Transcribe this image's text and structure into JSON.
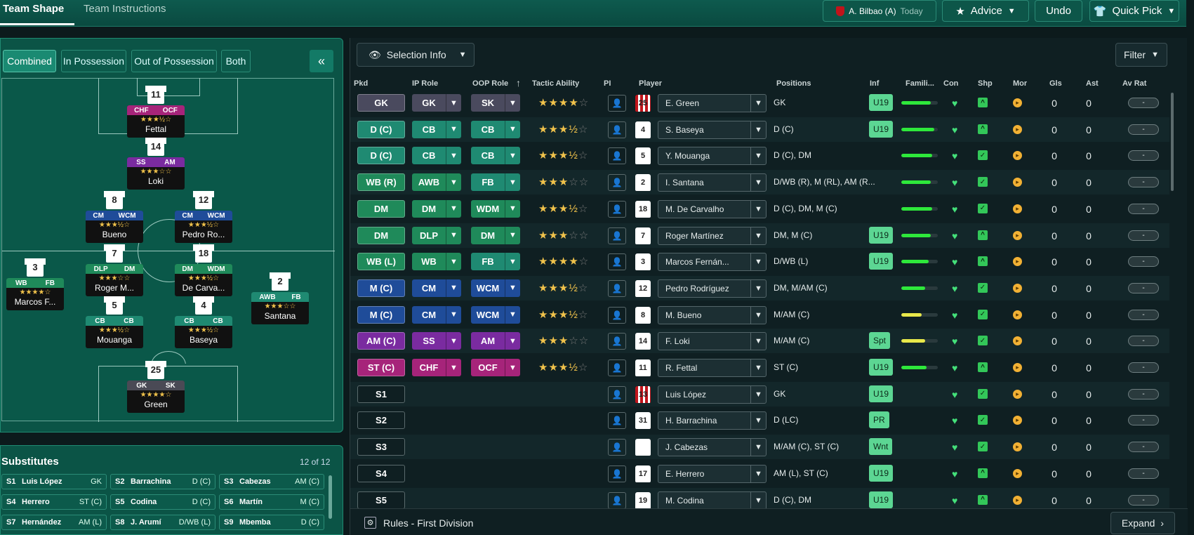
{
  "tabs": {
    "team_shape": "Team Shape",
    "team_instructions": "Team Instructions"
  },
  "topbar": {
    "match": "A. Bilbao (A)",
    "when": "Today",
    "advice": "Advice",
    "undo": "Undo",
    "quick_pick": "Quick Pick"
  },
  "view_modes": [
    "Combined",
    "In Possession",
    "Out of Possession",
    "Both"
  ],
  "collapse_glyph": "«",
  "pitch_players": [
    {
      "num": "11",
      "roles": [
        "CHF",
        "OCF"
      ],
      "color": "#a6247a",
      "stars": "★★★½☆",
      "name": "Fettal"
    },
    {
      "num": "14",
      "roles": [
        "SS",
        "AM"
      ],
      "color": "#7a2ba0",
      "stars": "★★★☆☆",
      "name": "Loki"
    },
    {
      "num": "8",
      "roles": [
        "CM",
        "WCM"
      ],
      "color": "#1f4c99",
      "stars": "★★★½☆",
      "name": "Bueno"
    },
    {
      "num": "12",
      "roles": [
        "CM",
        "WCM"
      ],
      "color": "#1f4c99",
      "stars": "★★★½☆",
      "name": "Pedro Ro..."
    },
    {
      "num": "3",
      "roles": [
        "WB",
        "FB"
      ],
      "color": "#1f8a5a",
      "stars": "★★★★☆",
      "name": "Marcos F..."
    },
    {
      "num": "7",
      "roles": [
        "DLP",
        "DM"
      ],
      "color": "#1f8a5a",
      "stars": "★★★☆☆",
      "name": "Roger M..."
    },
    {
      "num": "18",
      "roles": [
        "DM",
        "WDM"
      ],
      "color": "#1f8a5a",
      "stars": "★★★½☆",
      "name": "De Carva..."
    },
    {
      "num": "2",
      "roles": [
        "AWB",
        "FB"
      ],
      "color": "#1f8a72",
      "stars": "★★★☆☆",
      "name": "Santana"
    },
    {
      "num": "5",
      "roles": [
        "CB",
        "CB"
      ],
      "color": "#1f8a72",
      "stars": "★★★½☆",
      "name": "Mouanga"
    },
    {
      "num": "4",
      "roles": [
        "CB",
        "CB"
      ],
      "color": "#1f8a72",
      "stars": "★★★½☆",
      "name": "Baseya"
    },
    {
      "num": "25",
      "roles": [
        "GK",
        "SK"
      ],
      "color": "#4a4a55",
      "stars": "★★★★☆",
      "name": "Green"
    }
  ],
  "substitutes": {
    "title": "Substitutes",
    "count": "12 of 12",
    "items": [
      {
        "n": "S1",
        "name": "Luis López",
        "pos": "GK"
      },
      {
        "n": "S2",
        "name": "Barrachina",
        "pos": "D (C)"
      },
      {
        "n": "S3",
        "name": "Cabezas",
        "pos": "AM (C)"
      },
      {
        "n": "S4",
        "name": "Herrero",
        "pos": "ST (C)"
      },
      {
        "n": "S5",
        "name": "Codina",
        "pos": "D (C)"
      },
      {
        "n": "S6",
        "name": "Martín",
        "pos": "M (C)"
      },
      {
        "n": "S7",
        "name": "Hernández",
        "pos": "AM (L)"
      },
      {
        "n": "S8",
        "name": "J. Arumí",
        "pos": "D/WB (L)"
      },
      {
        "n": "S9",
        "name": "Mbemba",
        "pos": "D (C)"
      }
    ]
  },
  "selection_info": "Selection Info",
  "filter": "Filter",
  "columns": [
    "Pkd",
    "IP Role",
    "OOP Role",
    "Tactic Ability",
    "PI",
    "Player",
    "Positions",
    "Inf",
    "Famili...",
    "Con",
    "Shp",
    "Mor",
    "Gls",
    "Ast",
    "Av Rat"
  ],
  "rows": [
    {
      "pkd": "GK",
      "pc": "#4a4a5e",
      "ip": "GK",
      "ipc": "#4a4a5e",
      "oop": "SK",
      "oopc": "#4a4a5e",
      "stars": "★★★★",
      "empty": "☆",
      "kit": "25",
      "gk": true,
      "player": "E. Green",
      "pos": "GK",
      "inf": "U19",
      "fam": 0.8,
      "shp": "^",
      "gls": "0",
      "ast": "0",
      "rat": "-"
    },
    {
      "pkd": "D (C)",
      "pc": "#1f8a72",
      "ip": "CB",
      "ipc": "#1f8a72",
      "oop": "CB",
      "oopc": "#1f8a72",
      "stars": "★★★½",
      "empty": "☆",
      "kit": "4",
      "player": "S. Baseya",
      "pos": "D (C)",
      "inf": "U19",
      "fam": 0.9,
      "shp": "^",
      "gls": "0",
      "ast": "0",
      "rat": "-"
    },
    {
      "pkd": "D (C)",
      "pc": "#1f8a72",
      "ip": "CB",
      "ipc": "#1f8a72",
      "oop": "CB",
      "oopc": "#1f8a72",
      "stars": "★★★½",
      "empty": "☆",
      "kit": "5",
      "player": "Y. Mouanga",
      "pos": "D (C), DM",
      "inf": "",
      "fam": 0.85,
      "shp": "✓",
      "gls": "0",
      "ast": "0",
      "rat": "-"
    },
    {
      "pkd": "WB (R)",
      "pc": "#1f8a5a",
      "ip": "AWB",
      "ipc": "#1f8a5a",
      "oop": "FB",
      "oopc": "#1f8a72",
      "stars": "★★★",
      "empty": "☆☆",
      "kit": "2",
      "player": "I. Santana",
      "pos": "D/WB (R), M (RL), AM (R...",
      "inf": "",
      "fam": 0.8,
      "shp": "✓",
      "gls": "0",
      "ast": "0",
      "rat": "-"
    },
    {
      "pkd": "DM",
      "pc": "#1f8a5a",
      "ip": "DM",
      "ipc": "#1f8a5a",
      "oop": "WDM",
      "oopc": "#1f8a5a",
      "stars": "★★★½",
      "empty": "☆",
      "kit": "18",
      "player": "M. De Carvalho",
      "pos": "D (C), DM, M (C)",
      "inf": "",
      "fam": 0.85,
      "shp": "✓",
      "gls": "0",
      "ast": "0",
      "rat": "-"
    },
    {
      "pkd": "DM",
      "pc": "#1f8a5a",
      "ip": "DLP",
      "ipc": "#1f8a5a",
      "oop": "DM",
      "oopc": "#1f8a5a",
      "stars": "★★★",
      "empty": "☆☆",
      "kit": "7",
      "player": "Roger Martínez",
      "pos": "DM, M (C)",
      "inf": "U19",
      "fam": 0.8,
      "shp": "^",
      "gls": "0",
      "ast": "0",
      "rat": "-"
    },
    {
      "pkd": "WB (L)",
      "pc": "#1f8a5a",
      "ip": "WB",
      "ipc": "#1f8a5a",
      "oop": "FB",
      "oopc": "#1f8a72",
      "stars": "★★★★",
      "empty": "☆",
      "kit": "3",
      "player": "Marcos Fernán...",
      "pos": "D/WB (L)",
      "inf": "U19",
      "fam": 0.75,
      "shp": "^",
      "gls": "0",
      "ast": "0",
      "rat": "-"
    },
    {
      "pkd": "M (C)",
      "pc": "#1f4c99",
      "ip": "CM",
      "ipc": "#1f4c99",
      "oop": "WCM",
      "oopc": "#1f4c99",
      "stars": "★★★½",
      "empty": "☆",
      "kit": "12",
      "player": "Pedro Rodríguez",
      "pos": "DM, M/AM (C)",
      "inf": "",
      "fam": 0.65,
      "shp": "✓",
      "gls": "0",
      "ast": "0",
      "rat": "-"
    },
    {
      "pkd": "M (C)",
      "pc": "#1f4c99",
      "ip": "CM",
      "ipc": "#1f4c99",
      "oop": "WCM",
      "oopc": "#1f4c99",
      "stars": "★★★½",
      "empty": "☆",
      "kit": "8",
      "player": "M. Bueno",
      "pos": "M/AM (C)",
      "inf": "",
      "fam": 0.55,
      "fcol": "#e8e84a",
      "shp": "✓",
      "gls": "0",
      "ast": "0",
      "rat": "-"
    },
    {
      "pkd": "AM (C)",
      "pc": "#7a2ba0",
      "ip": "SS",
      "ipc": "#7a2ba0",
      "oop": "AM",
      "oopc": "#7a2ba0",
      "stars": "★★★",
      "empty": "☆☆",
      "kit": "14",
      "player": "F. Loki",
      "pos": "M/AM (C)",
      "inf": "Spt",
      "fam": 0.65,
      "fcol": "#e8e84a",
      "shp": "✓",
      "gls": "0",
      "ast": "0",
      "rat": "-"
    },
    {
      "pkd": "ST (C)",
      "pc": "#a6247a",
      "ip": "CHF",
      "ipc": "#a6247a",
      "oop": "OCF",
      "oopc": "#a6247a",
      "stars": "★★★½",
      "empty": "☆",
      "kit": "11",
      "player": "R. Fettal",
      "pos": "ST (C)",
      "inf": "U19",
      "fam": 0.7,
      "shp": "^",
      "gls": "0",
      "ast": "0",
      "rat": "-"
    },
    {
      "pkd": "S1",
      "pc": "",
      "ip": "",
      "oop": "",
      "stars": "",
      "empty": "",
      "kit": "13",
      "gk": true,
      "player": "Luis López",
      "pos": "GK",
      "inf": "U19",
      "fam": 0,
      "shp": "✓",
      "gls": "0",
      "ast": "0",
      "rat": "-"
    },
    {
      "pkd": "S2",
      "pc": "",
      "ip": "",
      "oop": "",
      "stars": "",
      "empty": "",
      "kit": "31",
      "player": "H. Barrachina",
      "pos": "D (LC)",
      "inf": "PR",
      "fam": 0,
      "shp": "✓",
      "gls": "0",
      "ast": "0",
      "rat": "-"
    },
    {
      "pkd": "S3",
      "pc": "",
      "ip": "",
      "oop": "",
      "stars": "",
      "empty": "",
      "kit": "",
      "player": "J. Cabezas",
      "pos": "M/AM (C), ST (C)",
      "inf": "Wnt",
      "fam": 0,
      "shp": "✓",
      "gls": "0",
      "ast": "0",
      "rat": "-"
    },
    {
      "pkd": "S4",
      "pc": "",
      "ip": "",
      "oop": "",
      "stars": "",
      "empty": "",
      "kit": "17",
      "player": "E. Herrero",
      "pos": "AM (L), ST (C)",
      "inf": "U19",
      "fam": 0,
      "shp": "^",
      "gls": "0",
      "ast": "0",
      "rat": "-"
    },
    {
      "pkd": "S5",
      "pc": "",
      "ip": "",
      "oop": "",
      "stars": "",
      "empty": "",
      "kit": "19",
      "player": "M. Codina",
      "pos": "D (C), DM",
      "inf": "U19",
      "fam": 0,
      "shp": "^",
      "gls": "0",
      "ast": "0",
      "rat": "-"
    }
  ],
  "footer": {
    "rules": "Rules - First Division",
    "expand": "Expand"
  }
}
